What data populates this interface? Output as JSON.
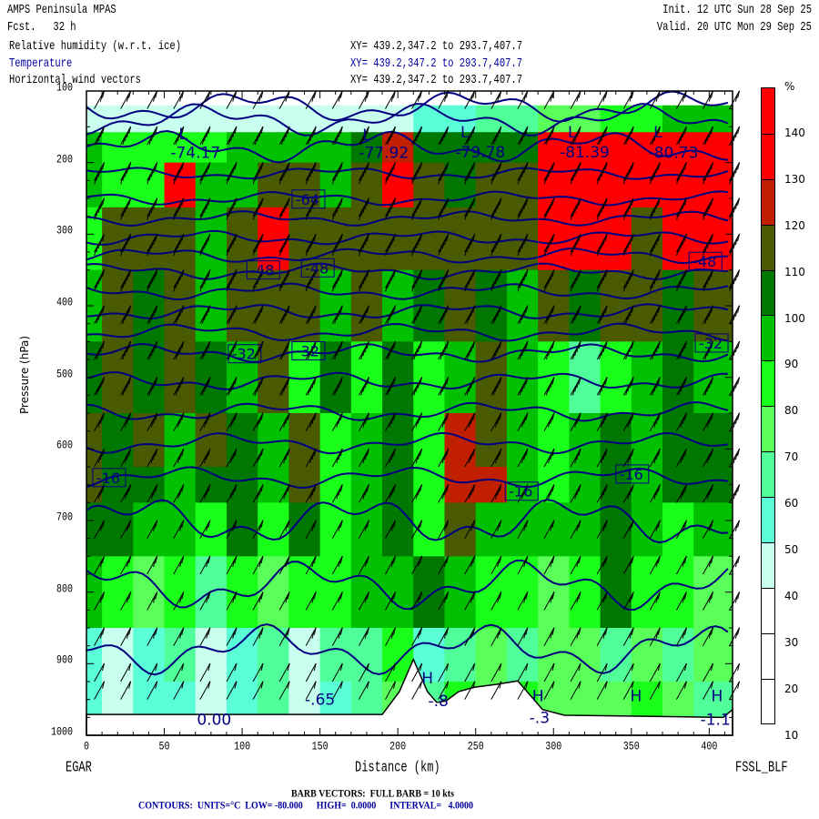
{
  "header": {
    "model": "AMPS Peninsula MPAS",
    "forecast": "Fcst.   32 h",
    "init": "Init. 12 UTC Sun 28 Sep 25",
    "valid": "Valid. 20 UTC Mon 29 Sep 25",
    "fields": [
      {
        "name": "Relative humidity (w.r.t. ice)",
        "xy": "XY= 439.2,347.2 to 293.7,407.7",
        "color": "#000000"
      },
      {
        "name": "Temperature",
        "xy": "XY= 439.2,347.2 to 293.7,407.7",
        "color": "#0000a0"
      },
      {
        "name": "Horizontal wind vectors",
        "xy": "XY= 439.2,347.2 to 293.7,407.7",
        "color": "#000000"
      }
    ]
  },
  "footer": {
    "start_point": "EGAR",
    "end_point": "FSSL_BLF",
    "barb_note": "BARB VECTORS:  FULL BARB = 10 kts",
    "contour_note": "CONTOURS:  UNITS=°C  LOW= -80.000      HIGH=  0.0000      INTERVAL=   4.0000"
  },
  "chart_data": {
    "type": "heatmap",
    "title": "Relative humidity (w.r.t. ice), Temperature, Horizontal wind vectors",
    "xlabel": "Distance (km)",
    "ylabel": "Pressure (hPa)",
    "xlim": [
      0,
      415
    ],
    "ylim": [
      1000,
      100
    ],
    "xticks": [
      "0",
      "50",
      "100",
      "150",
      "200",
      "250",
      "300",
      "350",
      "400"
    ],
    "yticks": [
      "100",
      "200",
      "300",
      "400",
      "500",
      "600",
      "700",
      "800",
      "900",
      "1000"
    ],
    "colorbar": {
      "unit": "%",
      "labels": [
        "140",
        "130",
        "120",
        "110",
        "100",
        "90",
        "80",
        "70",
        "60",
        "50",
        "40",
        "30",
        "20",
        "10"
      ],
      "bands": [
        {
          "from": 140,
          "to": 150,
          "color": "#ff0000"
        },
        {
          "from": 130,
          "to": 140,
          "color": "#ff0000"
        },
        {
          "from": 120,
          "to": 130,
          "color": "#ff0000"
        },
        {
          "from": 110,
          "to": 120,
          "color": "#c02000"
        },
        {
          "from": 100,
          "to": 110,
          "color": "#4a5a00"
        },
        {
          "from": 90,
          "to": 100,
          "color": "#007800"
        },
        {
          "from": 80,
          "to": 90,
          "color": "#00c000"
        },
        {
          "from": 70,
          "to": 80,
          "color": "#1aff1a"
        },
        {
          "from": 60,
          "to": 70,
          "color": "#5aff5a"
        },
        {
          "from": 50,
          "to": 60,
          "color": "#50ff9a"
        },
        {
          "from": 40,
          "to": 50,
          "color": "#5affd8"
        },
        {
          "from": 30,
          "to": 40,
          "color": "#c8ffee"
        },
        {
          "from": 20,
          "to": 30,
          "color": "#ffffff"
        },
        {
          "from": 10,
          "to": 20,
          "color": "#ffffff"
        },
        {
          "from": 0,
          "to": 10,
          "color": "#ffffff"
        }
      ]
    },
    "rh_grid": {
      "distance_km": [
        0,
        20,
        40,
        60,
        80,
        100,
        120,
        140,
        160,
        180,
        200,
        220,
        240,
        260,
        280,
        300,
        320,
        340,
        360,
        380,
        400
      ],
      "pressure_hpa": [
        100,
        140,
        175,
        225,
        300,
        400,
        500,
        600,
        650,
        700,
        800,
        900,
        950
      ],
      "values": [
        [
          10,
          10,
          10,
          10,
          10,
          10,
          10,
          10,
          10,
          10,
          10,
          10,
          10,
          10,
          10,
          10,
          10,
          10,
          10,
          10,
          10
        ],
        [
          30,
          30,
          30,
          30,
          30,
          30,
          30,
          30,
          30,
          30,
          35,
          40,
          45,
          50,
          55,
          60,
          65,
          70,
          75,
          80,
          80
        ],
        [
          80,
          75,
          70,
          70,
          75,
          80,
          80,
          80,
          85,
          95,
          115,
          95,
          90,
          90,
          95,
          125,
          125,
          125,
          125,
          120,
          120
        ],
        [
          80,
          70,
          70,
          120,
          80,
          85,
          105,
          105,
          85,
          105,
          125,
          105,
          90,
          105,
          105,
          125,
          125,
          130,
          125,
          125,
          125
        ],
        [
          75,
          105,
          105,
          105,
          85,
          105,
          120,
          105,
          105,
          105,
          105,
          105,
          105,
          105,
          105,
          125,
          125,
          120,
          105,
          125,
          125
        ],
        [
          85,
          105,
          95,
          105,
          85,
          105,
          105,
          105,
          85,
          105,
          80,
          95,
          105,
          95,
          85,
          105,
          95,
          105,
          105,
          95,
          105
        ],
        [
          90,
          105,
          95,
          105,
          95,
          85,
          105,
          75,
          95,
          70,
          95,
          75,
          80,
          105,
          80,
          70,
          55,
          75,
          80,
          95,
          85
        ],
        [
          105,
          95,
          105,
          85,
          105,
          95,
          80,
          105,
          70,
          80,
          95,
          75,
          115,
          105,
          80,
          75,
          80,
          95,
          85,
          95,
          95
        ],
        [
          105,
          95,
          95,
          85,
          95,
          95,
          80,
          105,
          70,
          80,
          95,
          75,
          115,
          115,
          80,
          75,
          80,
          95,
          85,
          95,
          95
        ],
        [
          95,
          95,
          80,
          85,
          70,
          95,
          75,
          95,
          70,
          80,
          95,
          70,
          105,
          80,
          80,
          80,
          85,
          95,
          80,
          75,
          80
        ],
        [
          80,
          75,
          65,
          75,
          55,
          70,
          65,
          70,
          75,
          80,
          85,
          95,
          80,
          70,
          75,
          65,
          75,
          90,
          75,
          70,
          65
        ],
        [
          45,
          35,
          45,
          50,
          35,
          45,
          55,
          35,
          50,
          55,
          75,
          45,
          50,
          65,
          55,
          60,
          65,
          55,
          65,
          55,
          65
        ],
        [
          45,
          38,
          45,
          45,
          35,
          45,
          50,
          35,
          45,
          55,
          60,
          50,
          70,
          65,
          70,
          60,
          65,
          60,
          70,
          60,
          55
        ]
      ]
    },
    "temperature_contours": [
      {
        "value": -80,
        "pressure_hpa": 122
      },
      {
        "value": -76,
        "pressure_hpa": 140
      },
      {
        "value": -72,
        "pressure_hpa": 178
      },
      {
        "value": -68,
        "pressure_hpa": 215
      },
      {
        "value": -64,
        "pressure_hpa": 250
      },
      {
        "value": -60,
        "pressure_hpa": 278
      },
      {
        "value": -56,
        "pressure_hpa": 305
      },
      {
        "value": -52,
        "pressure_hpa": 330
      },
      {
        "value": -48,
        "pressure_hpa": 352
      },
      {
        "value": -44,
        "pressure_hpa": 380
      },
      {
        "value": -40,
        "pressure_hpa": 408
      },
      {
        "value": -36,
        "pressure_hpa": 437
      },
      {
        "value": -32,
        "pressure_hpa": 466
      },
      {
        "value": -28,
        "pressure_hpa": 505
      },
      {
        "value": -24,
        "pressure_hpa": 548
      },
      {
        "value": -20,
        "pressure_hpa": 592
      },
      {
        "value": -16,
        "pressure_hpa": 640
      },
      {
        "value": -12,
        "pressure_hpa": 700
      },
      {
        "value": -8,
        "pressure_hpa": 790
      },
      {
        "value": -4,
        "pressure_hpa": 880
      }
    ],
    "contour_labels": [
      {
        "text": "-64",
        "km": 142,
        "hpa": 251,
        "boxed": true
      },
      {
        "text": "-48",
        "km": 113,
        "hpa": 350,
        "boxed": true
      },
      {
        "text": "-48",
        "km": 148,
        "hpa": 347,
        "boxed": true
      },
      {
        "text": "-48",
        "km": 397,
        "hpa": 338,
        "boxed": true
      },
      {
        "text": "-32",
        "km": 101,
        "hpa": 467,
        "boxed": true
      },
      {
        "text": "-32",
        "km": 142,
        "hpa": 463,
        "boxed": true
      },
      {
        "text": "-32",
        "km": 401,
        "hpa": 452,
        "boxed": true
      },
      {
        "text": "-16",
        "km": 14,
        "hpa": 640,
        "boxed": true
      },
      {
        "text": "-16",
        "km": 279,
        "hpa": 659,
        "boxed": true
      },
      {
        "text": "-16",
        "km": 350,
        "hpa": 635,
        "boxed": true
      },
      {
        "text": "-74.17",
        "km": 70,
        "hpa": 186,
        "boxed": false
      },
      {
        "text": "-77.92",
        "km": 191,
        "hpa": 186,
        "boxed": false
      },
      {
        "text": "-79.78",
        "km": 253,
        "hpa": 185,
        "boxed": false
      },
      {
        "text": "-81.39",
        "km": 320,
        "hpa": 185,
        "boxed": false
      },
      {
        "text": "-80.73",
        "km": 377,
        "hpa": 186,
        "boxed": false
      },
      {
        "text": "L",
        "km": 62,
        "hpa": 160,
        "boxed": false
      },
      {
        "text": "L",
        "km": 180,
        "hpa": 161,
        "boxed": false
      },
      {
        "text": "L",
        "km": 243,
        "hpa": 157,
        "boxed": false
      },
      {
        "text": "L",
        "km": 312,
        "hpa": 157,
        "boxed": false
      },
      {
        "text": "L",
        "km": 367,
        "hpa": 157,
        "boxed": false
      },
      {
        "text": "-.8",
        "km": 226,
        "hpa": 952,
        "boxed": false
      },
      {
        "text": "H",
        "km": 219,
        "hpa": 920,
        "boxed": false
      },
      {
        "text": "-.3",
        "km": 291,
        "hpa": 975,
        "boxed": false
      },
      {
        "text": "H",
        "km": 290,
        "hpa": 945,
        "boxed": false
      },
      {
        "text": "H",
        "km": 353,
        "hpa": 945,
        "boxed": false
      },
      {
        "text": "H",
        "km": 405,
        "hpa": 945,
        "boxed": false
      },
      {
        "text": "-1.1",
        "km": 404,
        "hpa": 978,
        "boxed": false
      },
      {
        "text": "0.00",
        "km": 82,
        "hpa": 978,
        "boxed": false
      },
      {
        "text": "-.65",
        "km": 150,
        "hpa": 950,
        "boxed": false
      }
    ],
    "terrain_profile": {
      "distance_km": [
        0,
        180,
        190,
        201,
        210,
        219,
        225,
        231,
        239,
        249,
        263,
        277,
        283,
        293,
        307,
        409,
        415
      ],
      "surface_pressure_hpa": [
        971,
        971,
        971,
        939,
        894,
        939,
        954,
        952,
        939,
        933,
        929,
        924,
        939,
        964,
        972,
        975,
        964
      ]
    },
    "wind_barbs": {
      "units": "kts",
      "full_barb_kts": 10,
      "levels_hpa": [
        125,
        175,
        225,
        275,
        325,
        375,
        425,
        475,
        525,
        575,
        625,
        675,
        725,
        775,
        825,
        875,
        925,
        950
      ],
      "speed_kts": [
        20,
        40,
        45,
        45,
        45,
        45,
        40,
        40,
        35,
        30,
        30,
        25,
        20,
        20,
        15,
        15,
        10,
        10
      ]
    }
  }
}
